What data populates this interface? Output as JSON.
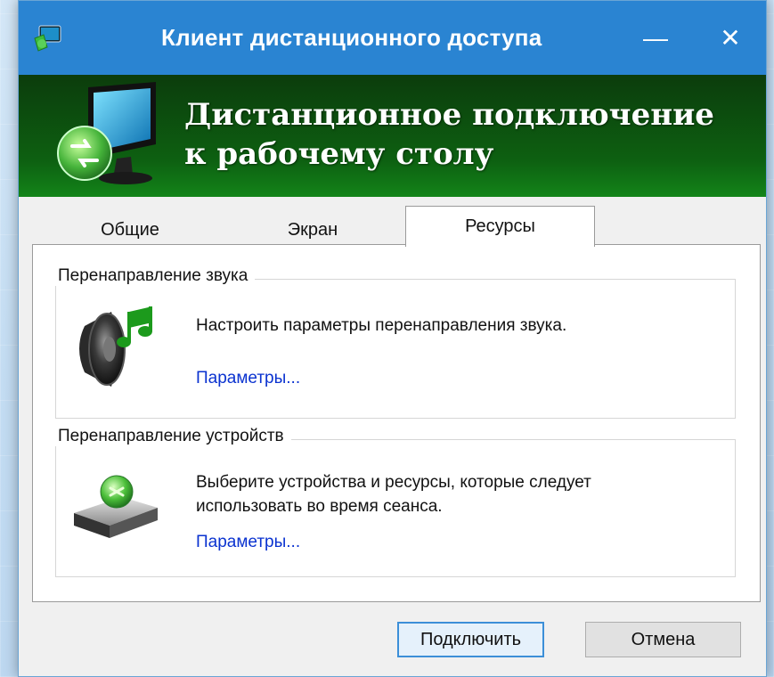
{
  "window": {
    "title": "Клиент дистанционного доступа",
    "minimize_glyph": "—",
    "close_glyph": "✕",
    "app_icon": "remote-desktop-icon"
  },
  "banner": {
    "title_line1": "Дистанционное подключение",
    "title_line2": "к рабочему столу",
    "icon": "monitor-connection-icon"
  },
  "tabs": [
    {
      "label": "Общие",
      "selected": false
    },
    {
      "label": "Экран",
      "selected": false
    },
    {
      "label": "Ресурсы",
      "selected": true
    }
  ],
  "groups": [
    {
      "legend": "Перенаправление звука",
      "description": "Настроить параметры перенаправления звука.",
      "link": "Параметры...",
      "icon": "speaker-icon"
    },
    {
      "legend": "Перенаправление устройств",
      "description_line1": "Выберите устройства и ресурсы, которые следует",
      "description_line2": "использовать во время сеанса.",
      "link": "Параметры...",
      "icon": "device-icon"
    }
  ],
  "buttons": {
    "connect": "Подключить",
    "cancel": "Отмена"
  },
  "colors": {
    "titlebar": "#2a84d2",
    "banner": "#0d6011",
    "link": "#0b33d0",
    "default_button_border": "#3c8fd8"
  }
}
